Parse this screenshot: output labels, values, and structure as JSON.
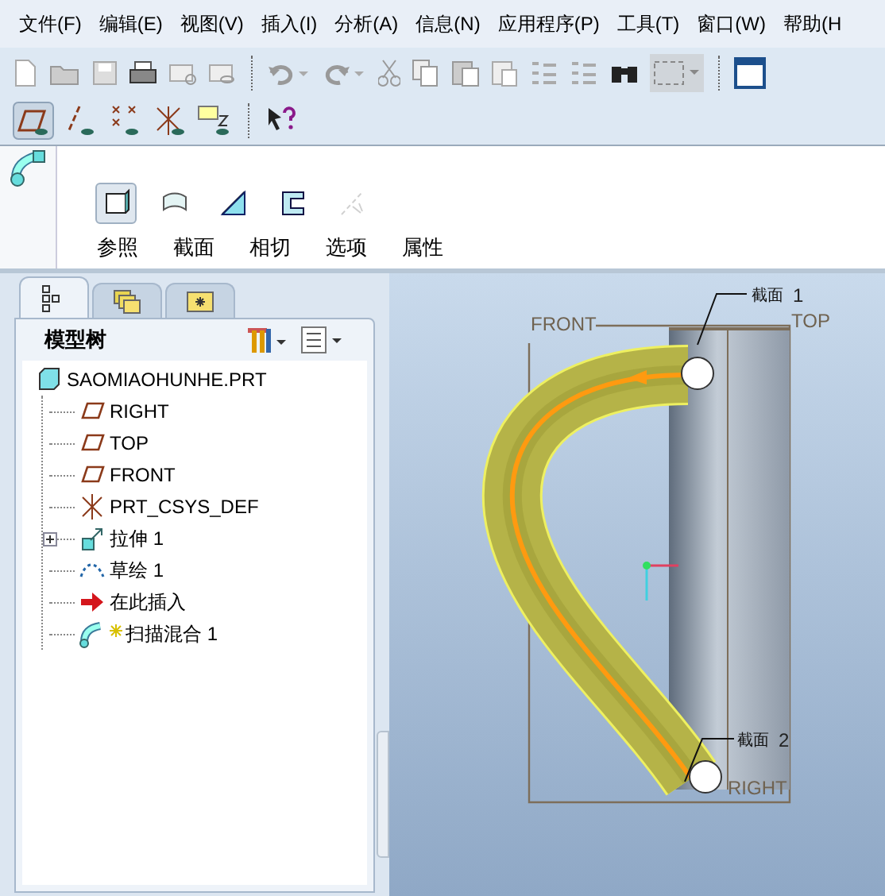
{
  "menu": [
    "文件(F)",
    "编辑(E)",
    "视图(V)",
    "插入(I)",
    "分析(A)",
    "信息(N)",
    "应用程序(P)",
    "工具(T)",
    "窗口(W)",
    "帮助(H"
  ],
  "dashboard": {
    "tool_buttons": [
      {
        "selected": true,
        "disabled": false
      },
      {
        "selected": false,
        "disabled": false
      },
      {
        "selected": false,
        "disabled": false
      },
      {
        "selected": false,
        "disabled": false
      },
      {
        "selected": false,
        "disabled": true
      }
    ],
    "panel_tabs": [
      "参照",
      "截面",
      "相切",
      "选项",
      "属性"
    ]
  },
  "navigator": {
    "tabs": [
      {
        "selected": true
      },
      {
        "selected": false
      },
      {
        "selected": false
      }
    ],
    "title": "模型树",
    "tree": {
      "label": "SAOMIAOHUNHE.PRT",
      "kind": "part",
      "children": [
        {
          "label": "RIGHT",
          "kind": "plane"
        },
        {
          "label": "TOP",
          "kind": "plane"
        },
        {
          "label": "FRONT",
          "kind": "plane"
        },
        {
          "label": "PRT_CSYS_DEF",
          "kind": "csys"
        },
        {
          "label": "拉伸 1",
          "kind": "extrude",
          "expanded": false
        },
        {
          "label": "草绘 1",
          "kind": "sketch"
        },
        {
          "label": "在此插入",
          "kind": "insert"
        },
        {
          "label": "扫描混合 1",
          "kind": "sweep"
        }
      ]
    }
  },
  "viewport": {
    "datum_labels": [
      "FRONT",
      "TOP",
      "RIGHT"
    ],
    "section_labels": [
      {
        "label": "截面",
        "number": "1"
      },
      {
        "label": "截面",
        "number": "2"
      }
    ]
  }
}
